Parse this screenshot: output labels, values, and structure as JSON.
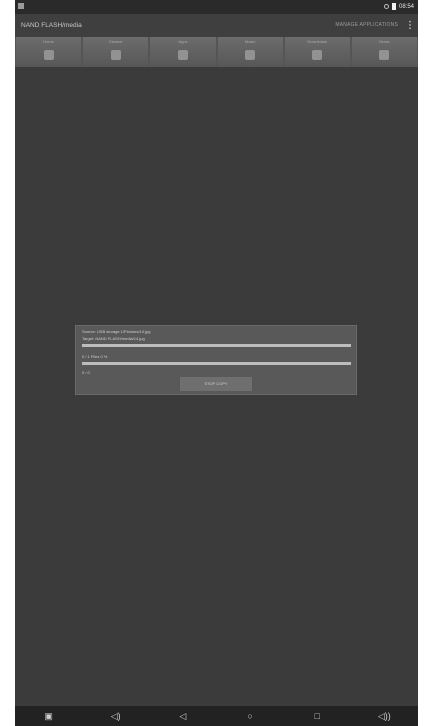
{
  "actionbar": {
    "title": "NAND FLASH/media",
    "manage_label": "MANAGE APPLICATIONS"
  },
  "statusbar": {
    "time": "08:54"
  },
  "toolbar": {
    "items": [
      {
        "label": "Home",
        "icon": "home-icon"
      },
      {
        "label": "Cleaner",
        "icon": "cleaner-icon"
      },
      {
        "label": "Apps",
        "icon": "apps-icon"
      },
      {
        "label": "Music",
        "icon": "music-icon"
      },
      {
        "label": "Downloads",
        "icon": "downloads-icon"
      },
      {
        "label": "Music",
        "icon": "file-icon"
      }
    ]
  },
  "dialog": {
    "source": "Source:   USB storage 1/Pictures/14.jpg",
    "target": "Target:   NAND FLASH/media/14.jpg",
    "progress_text": "0 / 1 Files 0 %",
    "size_text": "0 / 0",
    "stop_label": "STOP COPY"
  },
  "nav": {
    "icons": [
      "screenshot-icon",
      "volume-down-icon",
      "back-icon",
      "home-icon",
      "recents-icon",
      "volume-up-icon"
    ]
  }
}
